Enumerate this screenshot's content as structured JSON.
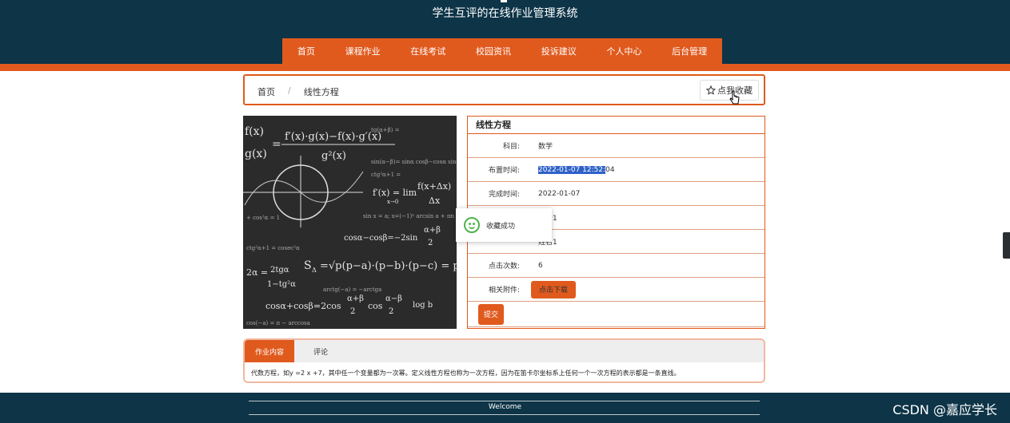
{
  "header": {
    "title": "学生互评的在线作业管理系统"
  },
  "nav": [
    "首页",
    "课程作业",
    "在线考试",
    "校园资讯",
    "投诉建议",
    "个人中心",
    "后台管理"
  ],
  "breadcrumb": {
    "home": "首页",
    "sep": "/",
    "current": "线性方程"
  },
  "favorite_button": {
    "icon": "star-icon",
    "label": "点我收藏"
  },
  "detail": {
    "title": "线性方程",
    "rows": [
      {
        "label": "科目:",
        "value": "数学"
      },
      {
        "label": "布置时间:",
        "value_selected": "2022-01-07 12:52:",
        "value_rest": "04"
      },
      {
        "label": "完成时间:",
        "value": "2022-01-07"
      },
      {
        "label": "",
        "value": "工号1"
      },
      {
        "label": "",
        "value": "姓名1"
      },
      {
        "label": "点击次数:",
        "value": "6"
      },
      {
        "label": "相关附件:",
        "button": "点击下载"
      }
    ],
    "submit": "提交"
  },
  "toast": {
    "icon": "smile-icon",
    "message": "收藏成功"
  },
  "tabs": {
    "active": "作业内容",
    "other": "评论"
  },
  "content": "代数方程，如y =2 x +7，其中任一个变量都为一次幂。定义线性方程也称为一次方程，因为在笛卡尔坐标系上任何一个一次方程的表示都是一条直线。",
  "footer": {
    "welcome": "Welcome"
  },
  "watermark": "CSDN @嘉应学长",
  "colors": {
    "navy": "#0d3447",
    "accent": "#e05a1e",
    "selection": "#2f62c7"
  }
}
